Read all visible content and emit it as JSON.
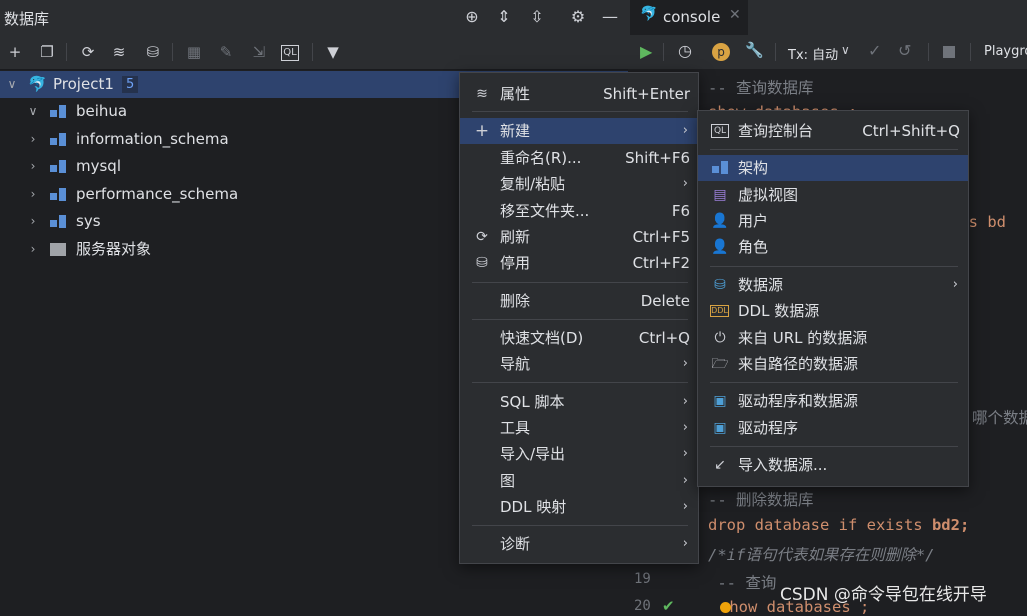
{
  "db_panel": {
    "title": "数据库",
    "project": {
      "name": "Project1",
      "count": "5"
    },
    "schemas": [
      "beihua",
      "information_schema",
      "mysql",
      "performance_schema",
      "sys"
    ],
    "server_objects": "服务器对象"
  },
  "editor": {
    "tab_label": "console",
    "tx_label": "Tx: 自动",
    "playground_label": "Playgro",
    "lines": {
      "l1": "-- 查询数据库",
      "l2": "show databases ;",
      "l3": "sts bd",
      "l4": "哪个数据",
      "l5": "-- 删除数据库",
      "l6_kw1": "drop database if exists",
      "l6_id": " bd2;",
      "l7": "/*if语句代表如果存在则删除*/",
      "l8": " -- 查询",
      "l9": "show databases ;"
    },
    "line_numbers": [
      "19",
      "20"
    ]
  },
  "context_menu": {
    "items": [
      {
        "label": "属性",
        "shortcut": "Shift+Enter",
        "icon": "properties-icon"
      },
      {
        "label": "新建",
        "shortcut": "",
        "icon": "plus-icon",
        "submenu": true
      },
      {
        "label": "重命名(R)...",
        "shortcut": "Shift+F6"
      },
      {
        "label": "复制/粘贴",
        "shortcut": "",
        "submenu": true
      },
      {
        "label": "移至文件夹...",
        "shortcut": "F6"
      },
      {
        "label": "刷新",
        "shortcut": "Ctrl+F5",
        "icon": "refresh-icon"
      },
      {
        "label": "停用",
        "shortcut": "Ctrl+F2",
        "icon": "disconnect-icon"
      },
      {
        "label": "删除",
        "shortcut": "Delete"
      },
      {
        "label": "快速文档(D)",
        "shortcut": "Ctrl+Q"
      },
      {
        "label": "导航",
        "shortcut": "",
        "submenu": true
      },
      {
        "label": "SQL 脚本",
        "shortcut": "",
        "submenu": true
      },
      {
        "label": "工具",
        "shortcut": "",
        "submenu": true
      },
      {
        "label": "导入/导出",
        "shortcut": "",
        "submenu": true
      },
      {
        "label": "图",
        "shortcut": "",
        "submenu": true
      },
      {
        "label": "DDL 映射",
        "shortcut": "",
        "submenu": true
      },
      {
        "label": "诊断",
        "shortcut": "",
        "submenu": true
      }
    ]
  },
  "submenu": {
    "items": [
      {
        "label": "查询控制台",
        "shortcut": "Ctrl+Shift+Q"
      },
      {
        "label": "架构",
        "shortcut": ""
      },
      {
        "label": "虚拟视图",
        "shortcut": ""
      },
      {
        "label": "用户",
        "shortcut": ""
      },
      {
        "label": "角色",
        "shortcut": ""
      },
      {
        "label": "数据源",
        "shortcut": ""
      },
      {
        "label": "DDL 数据源",
        "shortcut": ""
      },
      {
        "label": "来自 URL 的数据源",
        "shortcut": ""
      },
      {
        "label": "来自路径的数据源",
        "shortcut": ""
      },
      {
        "label": "驱动程序和数据源",
        "shortcut": ""
      },
      {
        "label": "驱动程序",
        "shortcut": ""
      },
      {
        "label": "导入数据源...",
        "shortcut": ""
      }
    ]
  },
  "watermark": "CSDN @命令导包在线开导",
  "colors": {
    "accent": "#3574f0",
    "selection": "#2e436e",
    "panel": "#2b2d30",
    "bg": "#1e1f22"
  }
}
